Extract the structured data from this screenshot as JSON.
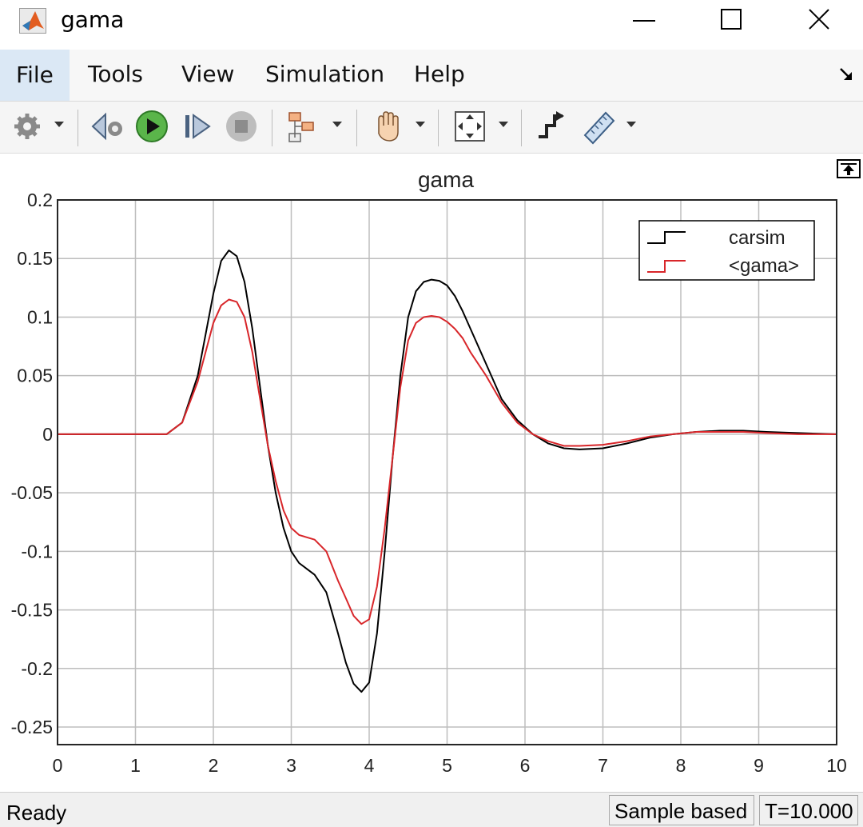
{
  "window": {
    "title": "gama"
  },
  "menu": {
    "items": [
      "File",
      "Tools",
      "View",
      "Simulation",
      "Help"
    ]
  },
  "toolbar": {
    "icons": [
      "gear-icon",
      "step-back-icon",
      "run-icon",
      "step-forward-icon",
      "stop-icon",
      "signal-tree-icon",
      "pan-hand-icon",
      "zoom-fit-icon",
      "style-icon",
      "measure-ruler-icon"
    ]
  },
  "status": {
    "state": "Ready",
    "mode": "Sample based",
    "time": "T=10.000"
  },
  "colors": {
    "black_series": "#000000",
    "red_series": "#d8262a",
    "grid": "#bdbdbd",
    "axes": "#262626"
  },
  "chart_data": {
    "type": "line",
    "title": "gama",
    "xlabel": "",
    "ylabel": "",
    "xlim": [
      0,
      10
    ],
    "ylim": [
      -0.265,
      0.2
    ],
    "xticks": [
      "0",
      "1",
      "2",
      "3",
      "4",
      "5",
      "6",
      "7",
      "8",
      "9",
      "10"
    ],
    "yticks": [
      "0.2",
      "0.15",
      "0.1",
      "0.05",
      "0",
      "-0.05",
      "-0.1",
      "-0.15",
      "-0.2",
      "-0.25"
    ],
    "grid": true,
    "legend_position": "top-right",
    "series": [
      {
        "name": "carsim",
        "color": "#000000",
        "x": [
          0,
          1.4,
          1.6,
          1.8,
          2.0,
          2.1,
          2.2,
          2.3,
          2.4,
          2.5,
          2.6,
          2.7,
          2.8,
          2.9,
          3.0,
          3.1,
          3.2,
          3.3,
          3.45,
          3.6,
          3.7,
          3.8,
          3.9,
          4.0,
          4.1,
          4.2,
          4.3,
          4.4,
          4.5,
          4.6,
          4.7,
          4.8,
          4.9,
          5.0,
          5.1,
          5.2,
          5.3,
          5.5,
          5.7,
          5.9,
          6.1,
          6.3,
          6.5,
          6.7,
          7.0,
          7.3,
          7.6,
          7.9,
          8.2,
          8.5,
          8.8,
          9.1,
          9.5,
          10
        ],
        "y": [
          0,
          0,
          0.01,
          0.05,
          0.12,
          0.148,
          0.157,
          0.152,
          0.13,
          0.09,
          0.04,
          -0.01,
          -0.05,
          -0.08,
          -0.1,
          -0.11,
          -0.115,
          -0.12,
          -0.135,
          -0.17,
          -0.195,
          -0.213,
          -0.22,
          -0.212,
          -0.17,
          -0.1,
          -0.02,
          0.05,
          0.1,
          0.122,
          0.13,
          0.132,
          0.131,
          0.127,
          0.118,
          0.105,
          0.09,
          0.06,
          0.03,
          0.012,
          0,
          -0.008,
          -0.012,
          -0.013,
          -0.012,
          -0.008,
          -0.003,
          0,
          0.002,
          0.003,
          0.003,
          0.002,
          0.001,
          0
        ]
      },
      {
        "name": "<gama>",
        "color": "#d8262a",
        "x": [
          0,
          1.4,
          1.6,
          1.8,
          2.0,
          2.1,
          2.2,
          2.3,
          2.4,
          2.5,
          2.6,
          2.7,
          2.8,
          2.9,
          3.0,
          3.1,
          3.2,
          3.3,
          3.45,
          3.6,
          3.7,
          3.8,
          3.9,
          4.0,
          4.1,
          4.2,
          4.3,
          4.4,
          4.5,
          4.6,
          4.7,
          4.8,
          4.9,
          5.0,
          5.1,
          5.2,
          5.3,
          5.5,
          5.7,
          5.9,
          6.1,
          6.3,
          6.5,
          6.7,
          7.0,
          7.3,
          7.6,
          7.9,
          8.2,
          8.5,
          8.8,
          9.1,
          9.5,
          10
        ],
        "y": [
          0,
          0,
          0.01,
          0.045,
          0.095,
          0.11,
          0.115,
          0.113,
          0.1,
          0.07,
          0.03,
          -0.01,
          -0.04,
          -0.065,
          -0.08,
          -0.086,
          -0.088,
          -0.09,
          -0.1,
          -0.125,
          -0.14,
          -0.155,
          -0.162,
          -0.158,
          -0.13,
          -0.08,
          -0.02,
          0.04,
          0.08,
          0.095,
          0.1,
          0.101,
          0.1,
          0.096,
          0.09,
          0.082,
          0.07,
          0.05,
          0.027,
          0.01,
          0,
          -0.006,
          -0.01,
          -0.01,
          -0.009,
          -0.006,
          -0.002,
          0,
          0.002,
          0.002,
          0.002,
          0.001,
          0,
          0
        ]
      }
    ]
  }
}
